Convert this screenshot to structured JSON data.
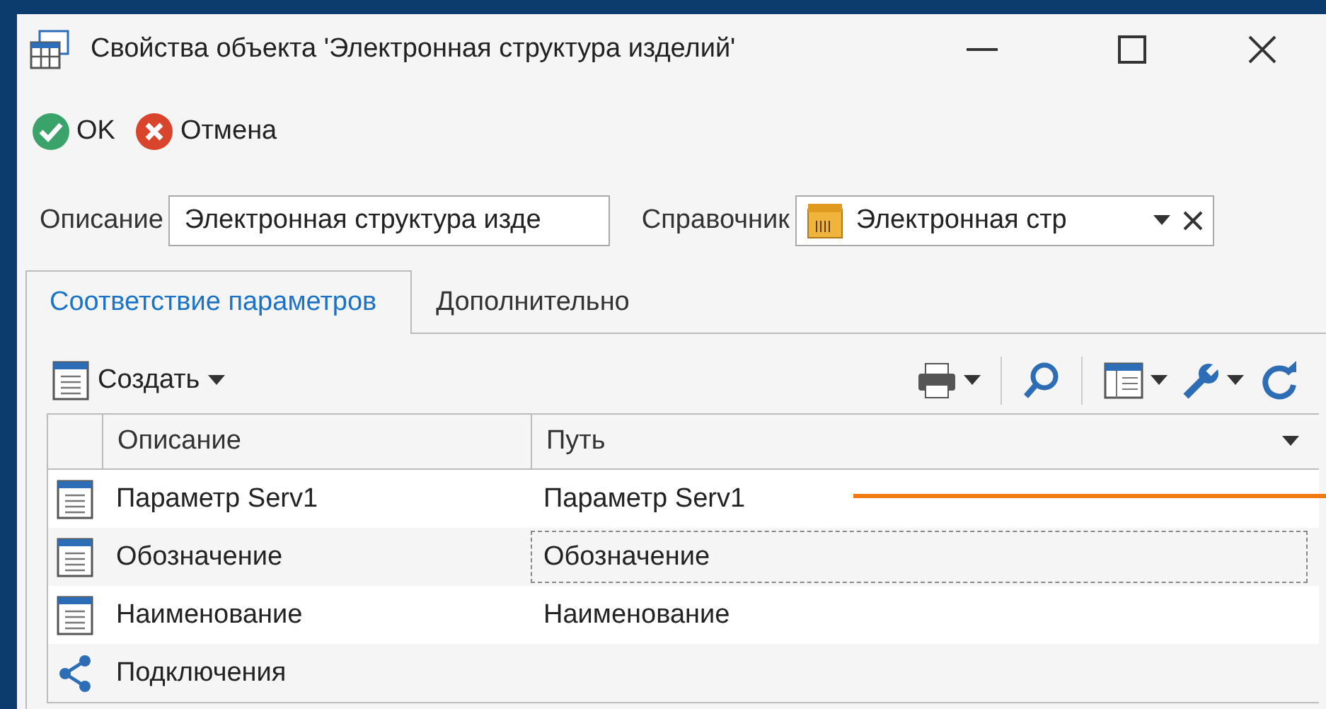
{
  "window": {
    "title": "Свойства объекта 'Электронная структура изделий'"
  },
  "actions": [
    {
      "kind": "ok",
      "label": "OK"
    },
    {
      "kind": "cancel",
      "label": "Отмена"
    }
  ],
  "fields": {
    "description": {
      "label": "Описание",
      "value": "Электронная структура изде"
    },
    "reference": {
      "label": "Справочник",
      "value": "Электронная стр"
    }
  },
  "tabs": [
    {
      "label": "Соответствие параметров",
      "selected": true
    },
    {
      "label": "Дополнительно",
      "selected": false
    }
  ],
  "grid_toolbar": {
    "create": "Создать"
  },
  "table": {
    "columns": [
      "Описание",
      "Путь"
    ],
    "rows": [
      {
        "kind": "item",
        "description": "Параметр Serv1",
        "path": "Параметр Serv1",
        "focused": false
      },
      {
        "kind": "item",
        "description": "Обозначение",
        "path": "Обозначение",
        "focused": true
      },
      {
        "kind": "item",
        "description": "Наименование",
        "path": "Наименование",
        "focused": false
      },
      {
        "kind": "link",
        "description": "Подключения",
        "focused": false
      }
    ]
  }
}
